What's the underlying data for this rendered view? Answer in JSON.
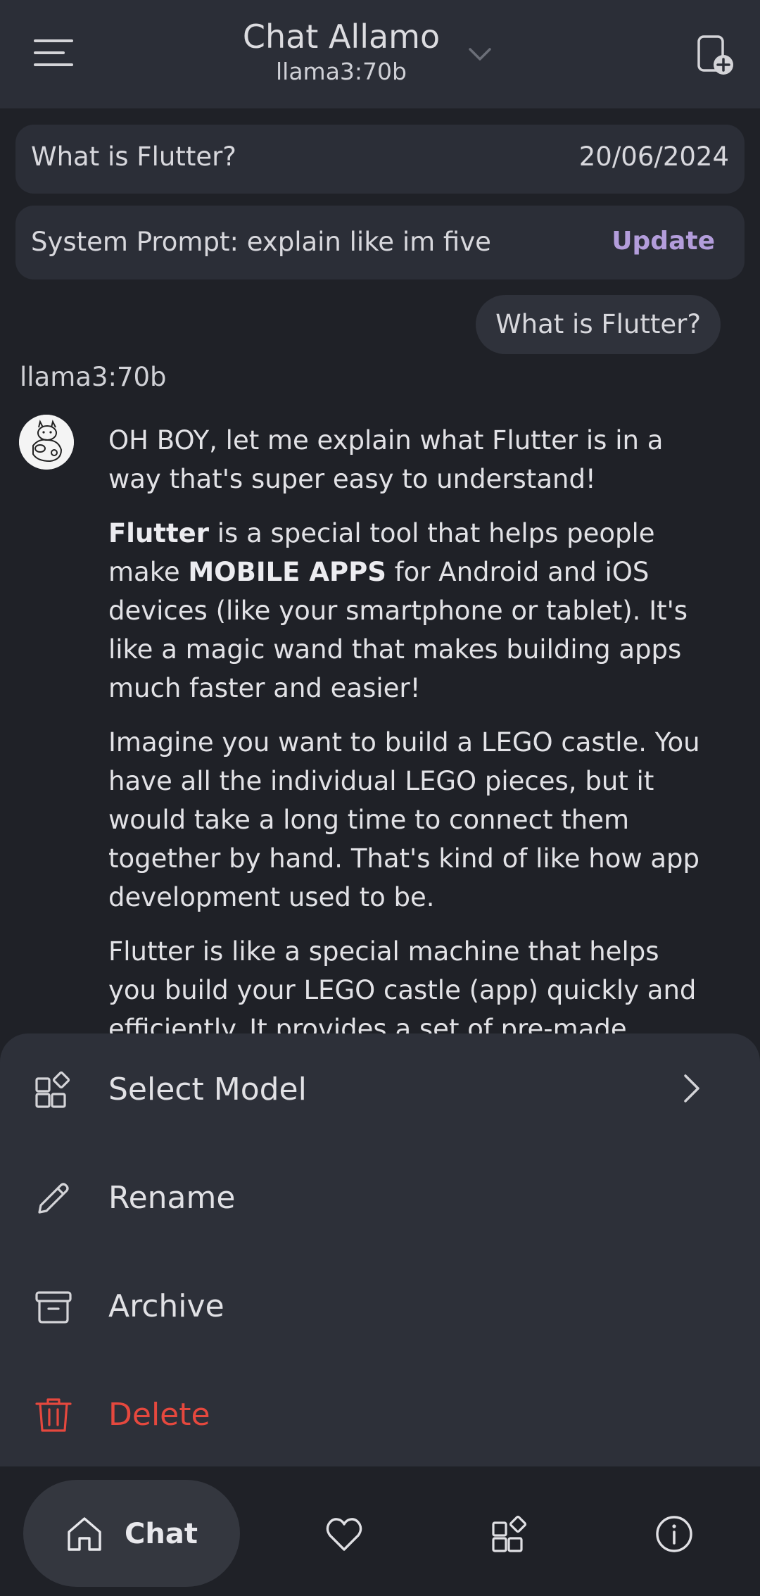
{
  "header": {
    "title": "Chat Allamo",
    "model": "llama3:70b",
    "icons": {
      "menu": "menu-icon",
      "dropdown": "chevron-down-icon",
      "new_chat": "new-chat-icon"
    }
  },
  "chat_card": {
    "title": "What is Flutter?",
    "date": "20/06/2024"
  },
  "system_prompt": {
    "text": "System Prompt: explain like im five",
    "update_label": "Update"
  },
  "user_message": "What is Flutter?",
  "assistant": {
    "name": "llama3:70b",
    "paragraphs": [
      {
        "text": "OH BOY, let me explain what Flutter is in a way that's super easy to understand!"
      },
      {
        "bold1": "Flutter",
        "text1": " is a special tool that helps people make ",
        "bold2": "MOBILE APPS",
        "text2": " for Android and iOS devices (like your smartphone or tablet). It's like a magic wand that makes building apps much faster and easier!"
      },
      {
        "text": "Imagine you want to build a LEGO castle. You have all the individual LEGO pieces, but it would take a long time to connect them together by hand. That's kind of like how app development used to be."
      },
      {
        "text": "Flutter is like a special machine that helps you build your LEGO castle (app) quickly and efficiently. It provides a set of pre-made"
      }
    ]
  },
  "sheet": {
    "items": [
      {
        "label": "Select Model",
        "icon": "widgets-icon"
      },
      {
        "label": "Rename",
        "icon": "pencil-icon"
      },
      {
        "label": "Archive",
        "icon": "archive-icon"
      },
      {
        "label": "Delete",
        "icon": "trash-icon"
      }
    ]
  },
  "nav": {
    "chat_label": "Chat",
    "icons": [
      "home-icon",
      "heart-icon",
      "widgets-icon",
      "info-icon"
    ]
  },
  "colors": {
    "background": "#1f2127",
    "surface": "#2b2e37",
    "sheet": "#2d3039",
    "accent": "#b39ddb",
    "danger": "#e5483e"
  }
}
